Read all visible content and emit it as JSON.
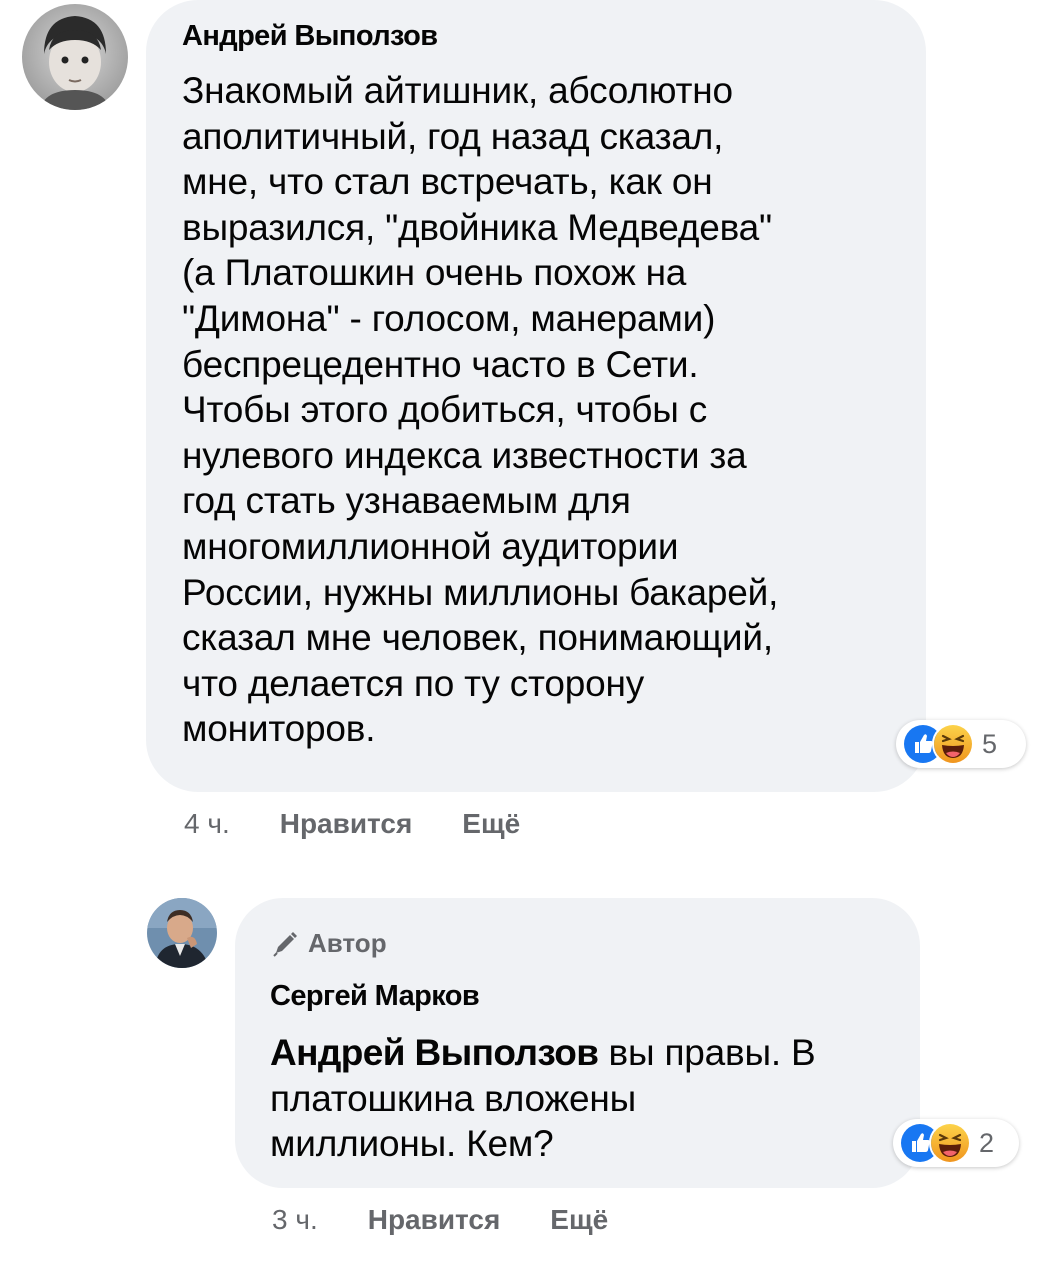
{
  "comments": [
    {
      "author": "Андрей Выползов",
      "text_lines": [
        "Знакомый айтишник, абсолютно",
        "аполитичный, год назад сказал,",
        "мне, что стал встречать, как он",
        "выразился, \"двойника Медведева\"",
        "(а Платошкин очень похож на",
        "\"Димона\" - голосом, манерами)",
        "беспрецедентно часто в Сети.",
        "Чтобы этого добиться, чтобы с",
        "нулевого индекса известности за",
        "год стать узнаваемым для",
        "многомиллионной аудитории",
        "России, нужны миллионы бакарей,",
        "сказал мне человек, понимающий,",
        "что делается по ту сторону",
        "мониторов."
      ],
      "reactions": {
        "icons": [
          "like-icon",
          "haha-icon"
        ],
        "count": "5"
      },
      "time": "4 ч.",
      "like_label": "Нравится",
      "more_label": "Ещё"
    },
    {
      "badge": "Автор",
      "author": "Сергей Марков",
      "mention": "Андрей Выползов",
      "text_first_rest": " вы правы. В",
      "text_lines_rest": [
        "платошкина вложены",
        "миллионы. Кем?"
      ],
      "reactions": {
        "icons": [
          "like-icon",
          "haha-icon"
        ],
        "count": "2"
      },
      "time": "3 ч.",
      "like_label": "Нравится",
      "more_label": "Ещё"
    }
  ],
  "colors": {
    "bubble": "#f0f2f5",
    "meta_text": "#65676b",
    "like_blue": "#1877f2",
    "haha_yellow": "#f7b125"
  }
}
